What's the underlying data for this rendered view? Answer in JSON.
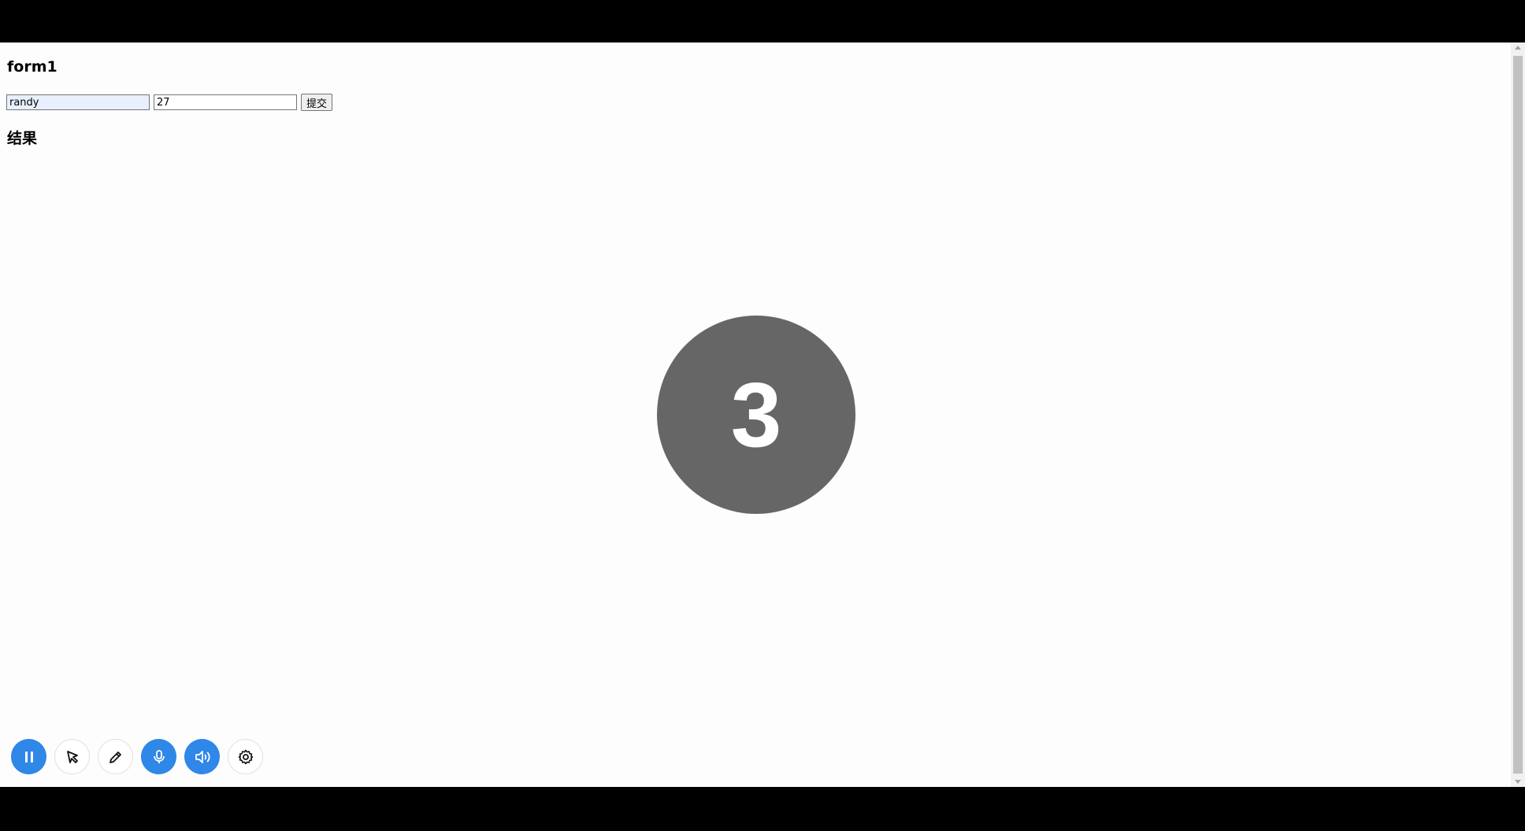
{
  "form": {
    "title": "form1",
    "name_value": "randy",
    "age_value": "27",
    "submit_label": "提交"
  },
  "result": {
    "title": "结果"
  },
  "countdown": {
    "number": "3"
  },
  "toolbar": {
    "buttons": [
      {
        "icon": "pause-icon",
        "active": true
      },
      {
        "icon": "cursor-icon",
        "active": false
      },
      {
        "icon": "pen-icon",
        "active": false
      },
      {
        "icon": "microphone-icon",
        "active": true
      },
      {
        "icon": "speaker-icon",
        "active": true
      },
      {
        "icon": "gear-icon",
        "active": false
      }
    ]
  },
  "colors": {
    "accent": "#2f87e8",
    "countdown_bg": "#666666",
    "page_bg": "#fdfdfd"
  }
}
